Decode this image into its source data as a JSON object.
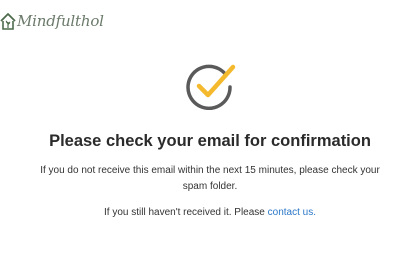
{
  "brand": {
    "name": "Mindfulthol",
    "logo_icon": "house-plant-icon",
    "color": "#4d6b4c"
  },
  "confirmation": {
    "icon": "checkmark-circle-icon",
    "icon_ring_color": "#5a5a5a",
    "icon_check_color": "#f4b92c",
    "heading": "Please check your email for confirmation",
    "instructions": "If you do not receive this email within the next 15 minutes, please check your spam folder.",
    "contact_prefix": "If you still haven't received it. Please ",
    "contact_link_label": "contact us.",
    "link_color": "#2a77c9"
  }
}
